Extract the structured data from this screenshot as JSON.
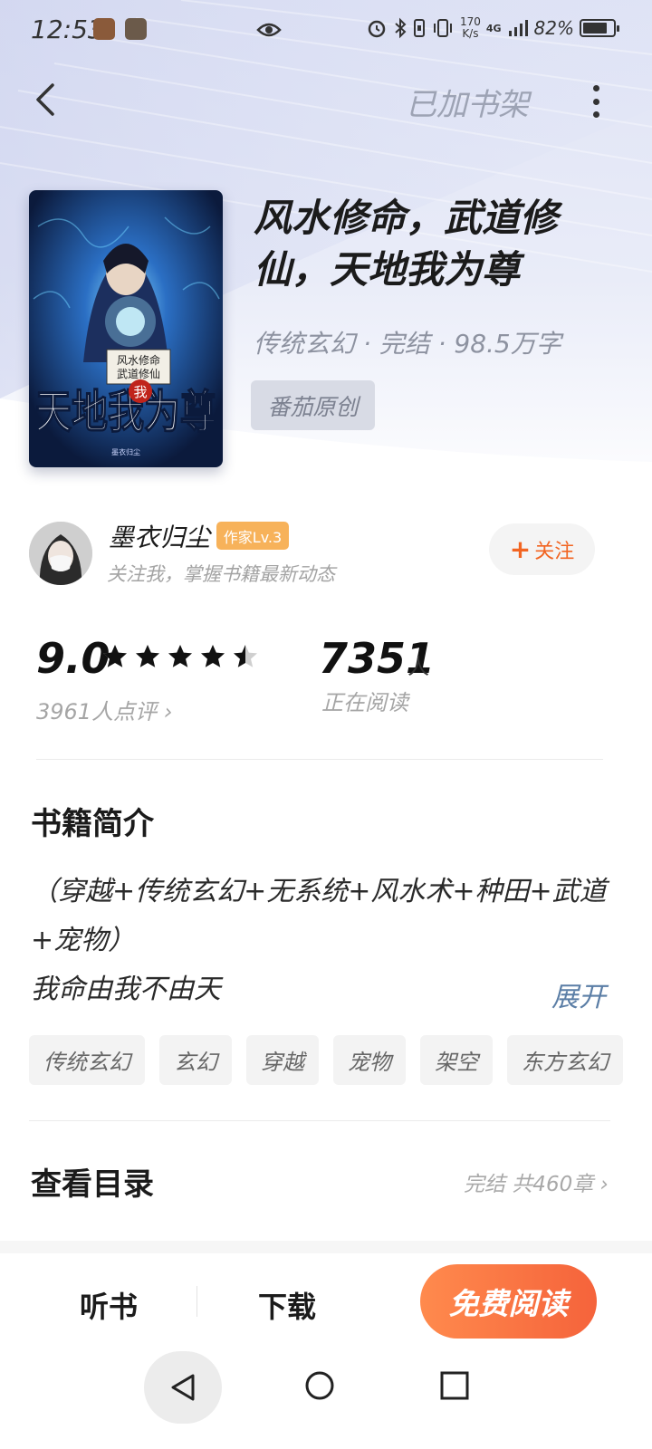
{
  "status_bar": {
    "time": "12:53",
    "network_speed_value": "170",
    "network_speed_unit": "K/s",
    "network_type": "4G",
    "battery_percent": "82%",
    "battery_level": 0.82
  },
  "header": {
    "shelf_status": "已加书架"
  },
  "book": {
    "title": "风水修命，武道修仙，天地我为尊",
    "meta": "传统玄幻 · 完结 · 98.5万字",
    "origin_tag": "番茄原创",
    "cover_subtitle_line1": "风水修命",
    "cover_subtitle_line2": "武道修仙",
    "cover_title": "天地我为尊",
    "cover_seal": "我",
    "cover_author": "墨衣归尘"
  },
  "author": {
    "name": "墨衣归尘",
    "badge": "作家Lv.3",
    "subtitle": "关注我，掌握书籍最新动态",
    "follow_plus": "+",
    "follow_label": "关注"
  },
  "rating": {
    "score": "9.0",
    "stars": 4.5,
    "count_text": "3961人点评 ›"
  },
  "readers": {
    "count": "7351",
    "unit": "人",
    "label": "正在阅读"
  },
  "intro": {
    "title": "书籍简介",
    "line1": "（穿越+传统玄幻+无系统+风水术+种田+武道+宠物）",
    "line2": "我命由我不由天",
    "expand_label": "展开",
    "tags": [
      "传统玄幻",
      "玄幻",
      "穿越",
      "宠物",
      "架空",
      "东方玄幻"
    ]
  },
  "catalog": {
    "title": "查看目录",
    "status": "完结 共460章 ›"
  },
  "bottom_bar": {
    "listen": "听书",
    "download": "下载",
    "read_free": "免费阅读"
  },
  "colors": {
    "accent_orange": "#f5633b",
    "badge_orange": "#f7b25a",
    "expand_blue": "#5b7ea6"
  }
}
